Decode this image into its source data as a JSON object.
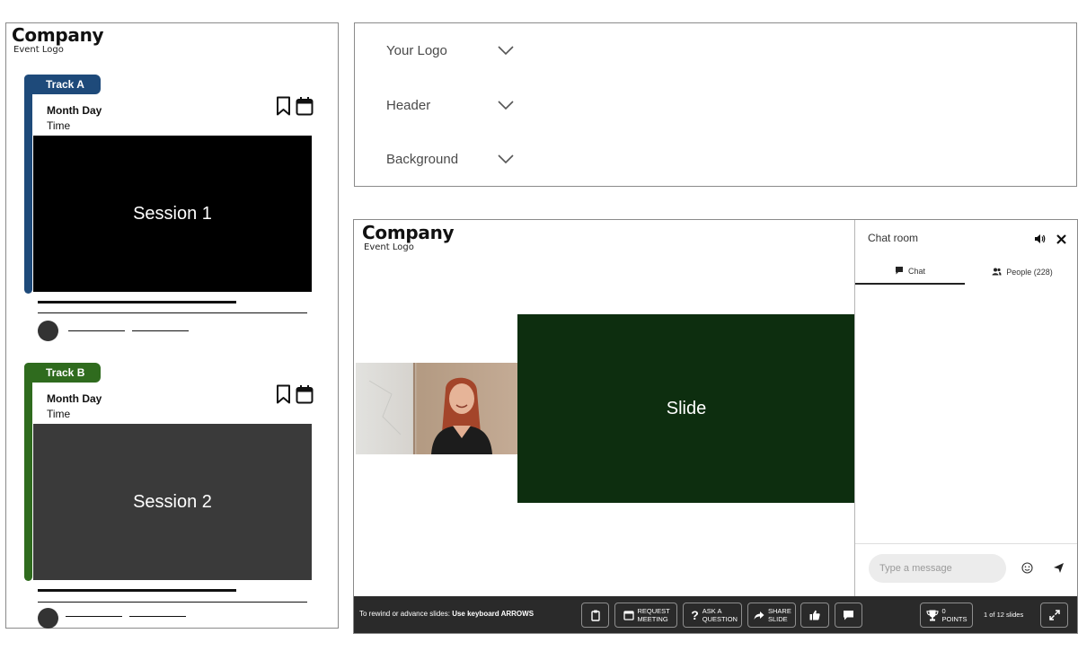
{
  "schedule": {
    "logo": {
      "company": "Company",
      "event": "Event Logo"
    },
    "cards": [
      {
        "track": "Track A",
        "date": "Month Day",
        "time": "Time",
        "session": "Session 1",
        "color": "#1e4a7a",
        "thumb_color": "#000000"
      },
      {
        "track": "Track B",
        "date": "Month Day",
        "time": "Time",
        "session": "Session 2",
        "color": "#2f6b1e",
        "thumb_color": "#3a3a3a"
      }
    ]
  },
  "customize": {
    "options": [
      {
        "label": "Your Logo"
      },
      {
        "label": "Header"
      },
      {
        "label": "Background"
      }
    ]
  },
  "player": {
    "logo": {
      "company": "Company",
      "event": "Event Logo"
    },
    "slide_label": "Slide",
    "slide_color": "#0d2e0f",
    "chat": {
      "title": "Chat room",
      "tab_chat": "Chat",
      "tab_people": "People (228)",
      "input_placeholder": "Type a message"
    },
    "toolbar": {
      "hint_prefix": "To rewind or advance slides:",
      "hint_bold": "Use keyboard ARROWS",
      "request_meeting": "Request Meeting",
      "ask_question": "Ask a Question",
      "share_slide": "Share Slide",
      "points": "0 Points",
      "slide_counter": "1 of 12 slides"
    }
  }
}
